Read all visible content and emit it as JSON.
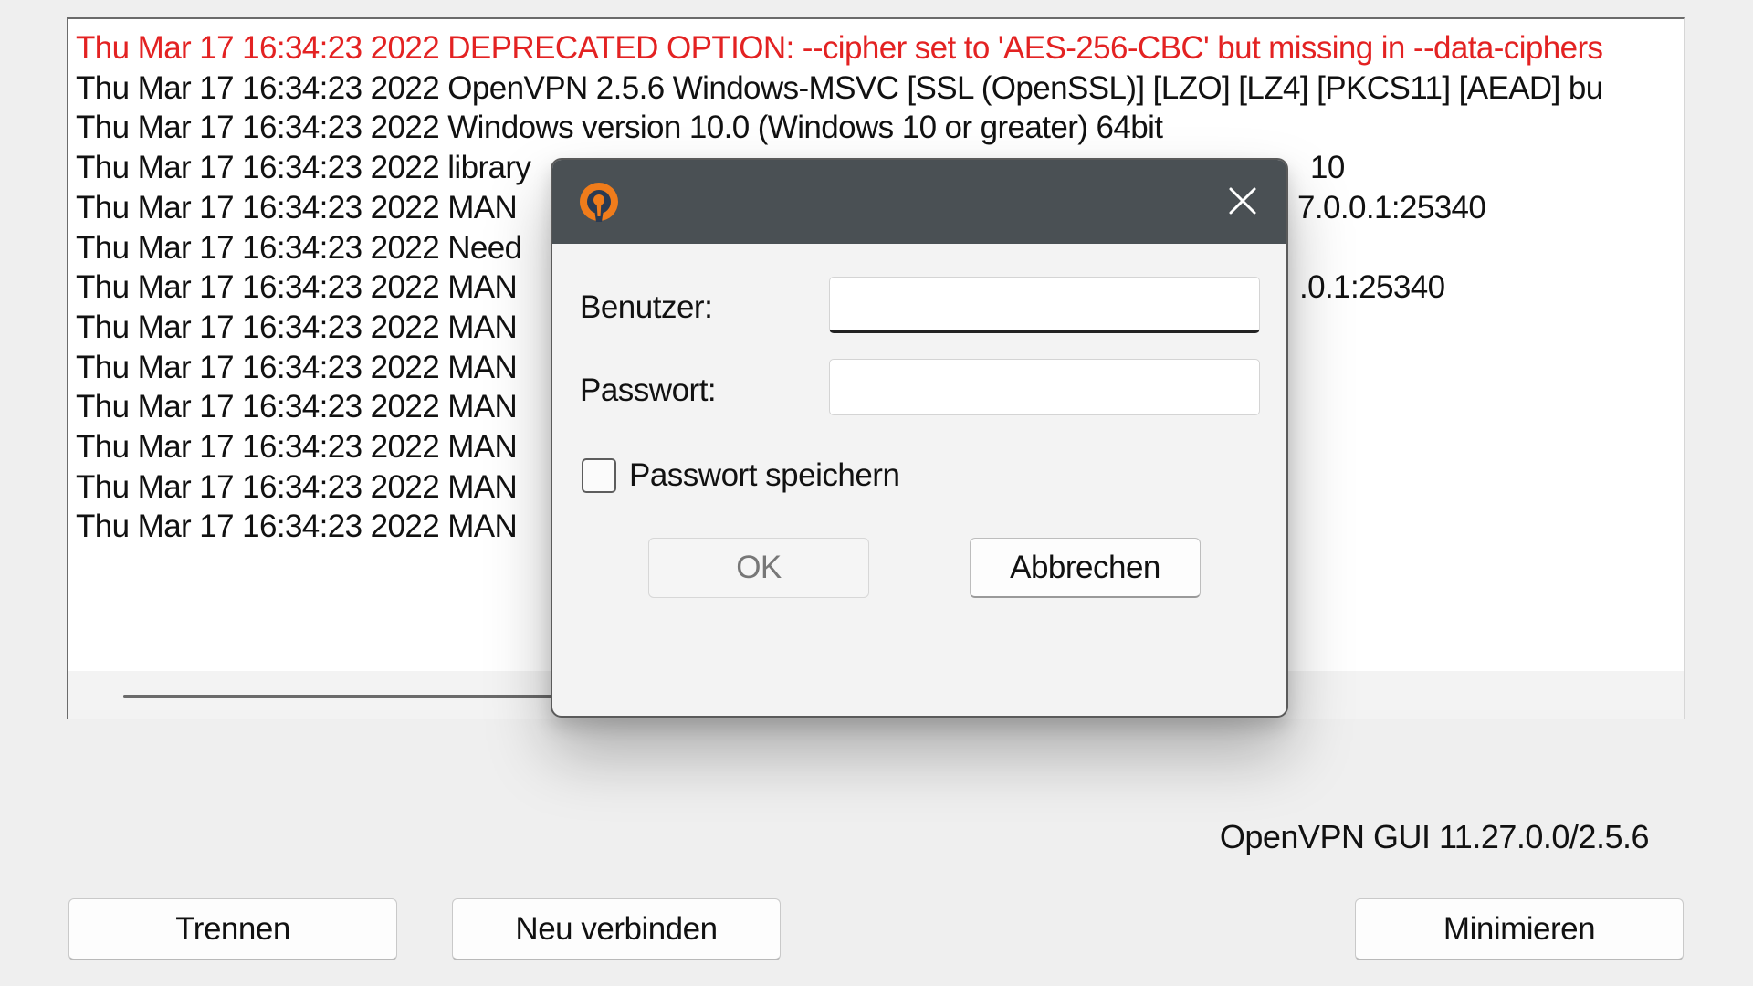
{
  "log": {
    "lines": [
      {
        "text": "Thu Mar 17 16:34:23 2022 DEPRECATED OPTION: --cipher set to 'AES-256-CBC' but missing in --data-ciphers",
        "level": "warn"
      },
      {
        "text": "Thu Mar 17 16:34:23 2022 OpenVPN 2.5.6 Windows-MSVC [SSL (OpenSSL)] [LZO] [LZ4] [PKCS11] [AEAD] bu",
        "level": "info"
      },
      {
        "text": "Thu Mar 17 16:34:23 2022 Windows version 10.0 (Windows 10 or greater) 64bit",
        "level": "info"
      },
      {
        "text": "Thu Mar 17 16:34:23 2022 library",
        "tail": "10",
        "level": "info"
      },
      {
        "text": "Thu Mar 17 16:34:23 2022 MAN",
        "tail": "7.0.0.1:25340",
        "level": "info"
      },
      {
        "text": "Thu Mar 17 16:34:23 2022 Need",
        "tail": "",
        "level": "info"
      },
      {
        "text": "Thu Mar 17 16:34:23 2022 MAN",
        "tail": ".0.1:25340",
        "level": "info"
      },
      {
        "text": "Thu Mar 17 16:34:23 2022 MAN",
        "tail": "",
        "level": "info"
      },
      {
        "text": "Thu Mar 17 16:34:23 2022 MAN",
        "tail": "",
        "level": "info"
      },
      {
        "text": "Thu Mar 17 16:34:23 2022 MAN",
        "tail": "",
        "level": "info"
      },
      {
        "text": "Thu Mar 17 16:34:23 2022 MAN",
        "tail": "",
        "level": "info"
      },
      {
        "text": "Thu Mar 17 16:34:23 2022 MAN",
        "tail": "",
        "level": "info"
      },
      {
        "text": "Thu Mar 17 16:34:23 2022 MAN",
        "tail": "",
        "level": "info"
      }
    ]
  },
  "footer": {
    "version": "OpenVPN GUI 11.27.0.0/2.5.6",
    "disconnect_label": "Trennen",
    "reconnect_label": "Neu verbinden",
    "minimize_label": "Minimieren"
  },
  "dialog": {
    "logo_icon": "openvpn-logo-icon",
    "close_icon": "close-icon",
    "user_label": "Benutzer:",
    "user_value": "",
    "password_label": "Passwort:",
    "password_value": "",
    "save_password_label": "Passwort speichern",
    "save_password_checked": false,
    "ok_label": "OK",
    "cancel_label": "Abbrechen"
  },
  "colors": {
    "warning_text": "#e32222",
    "titlebar": "#4a5054",
    "logo_orange": "#f07c1b"
  }
}
